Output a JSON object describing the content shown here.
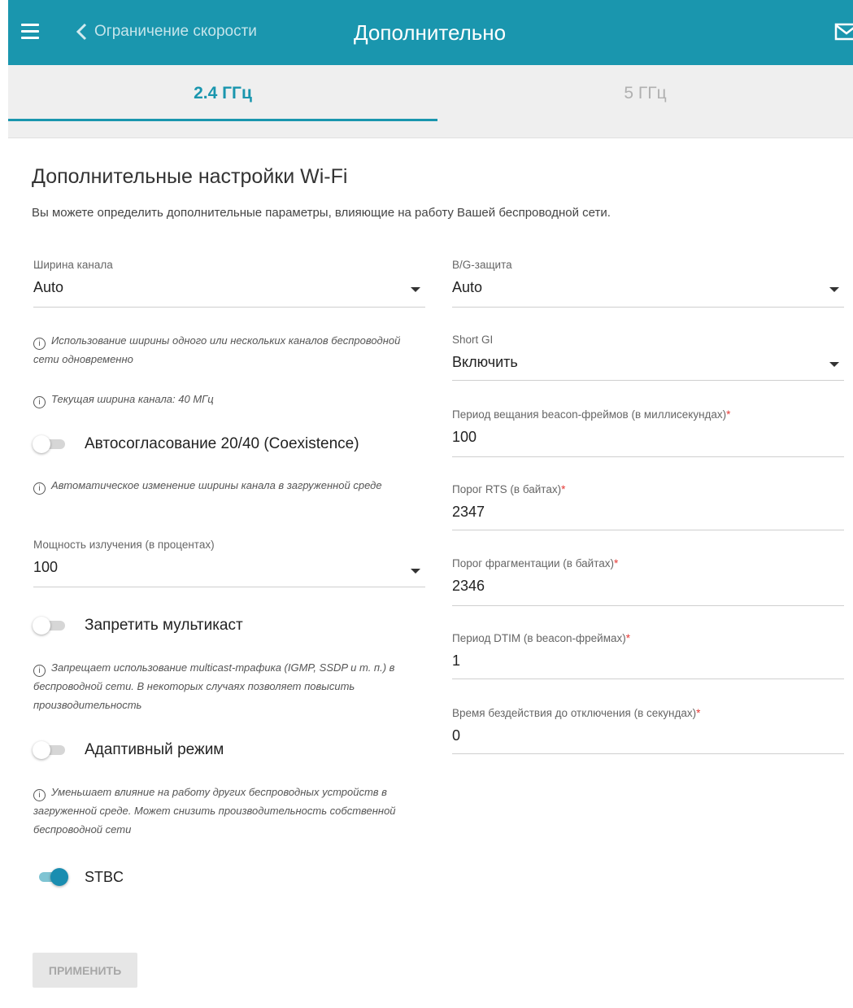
{
  "header": {
    "back_label": "Ограничение скорости",
    "title": "Дополнительно",
    "accent_color": "#1a96ae"
  },
  "tabs": [
    {
      "label": "2.4 ГГц",
      "active": true
    },
    {
      "label": "5 ГГц",
      "active": false
    }
  ],
  "section": {
    "title": "Дополнительные настройки Wi-Fi",
    "description": "Вы можете определить дополнительные параметры, влияющие на работу Вашей беспроводной сети."
  },
  "left": {
    "channel_width": {
      "label": "Ширина канала",
      "value": "Auto"
    },
    "channel_width_hint": "Использование ширины одного или нескольких каналов беспроводной сети одновременно",
    "current_width_hint": "Текущая ширина канала: 40 МГц",
    "coexistence": {
      "label": "Автосогласование 20/40 (Coexistence)",
      "on": false
    },
    "coexistence_hint": "Автоматическое изменение ширины канала в загруженной среде",
    "tx_power": {
      "label": "Мощность излучения (в процентах)",
      "value": "100"
    },
    "multicast": {
      "label": "Запретить мультикаст",
      "on": false
    },
    "multicast_hint": "Запрещает использование multicast-трафика (IGMP, SSDP и т. п.) в беспроводной сети. В некоторых случаях позволяет повысить производительность",
    "adaptive": {
      "label": "Адаптивный режим",
      "on": false
    },
    "adaptive_hint": "Уменьшает влияние на работу других беспроводных устройств в загруженной среде. Может снизить производительность собственной беспроводной сети",
    "stbc": {
      "label": "STBC",
      "on": true
    }
  },
  "right": {
    "bg_protection": {
      "label": "B/G-защита",
      "value": "Auto"
    },
    "short_gi": {
      "label": "Short GI",
      "value": "Включить"
    },
    "beacon_period": {
      "label": "Период вещания beacon-фреймов (в миллисекундах)",
      "value": "100"
    },
    "rts": {
      "label": "Порог RTS (в байтах)",
      "value": "2347"
    },
    "fragmentation": {
      "label": "Порог фрагментации (в байтах)",
      "value": "2346"
    },
    "dtim": {
      "label": "Период DTIM (в beacon-фреймах)",
      "value": "1"
    },
    "inactivity": {
      "label": "Время бездействия до отключения (в секундах)",
      "value": "0"
    }
  },
  "required_mark": "*",
  "info_glyph": "i",
  "apply_label": "ПРИМЕНИТЬ"
}
